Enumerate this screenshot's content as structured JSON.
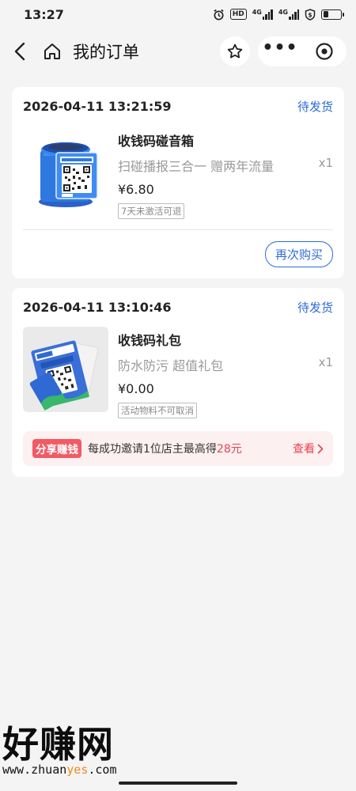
{
  "status_bar": {
    "time": "13:27",
    "hd": "HD",
    "net1": "4G",
    "net2": "4G",
    "battery_level": 0.3
  },
  "nav": {
    "title": "我的订单"
  },
  "orders": [
    {
      "time": "2026-04-11 13:21:59",
      "status": "待发货",
      "product_name": "收钱码碰音箱",
      "description": "扫碰播报三合一  赠两年流量",
      "quantity": "x1",
      "price": "¥6.80",
      "tag": "7天未激活可退",
      "action": "再次购买"
    },
    {
      "time": "2026-04-11 13:10:46",
      "status": "待发货",
      "product_name": "收钱码礼包",
      "description": "防水防污  超值礼包",
      "quantity": "x1",
      "price": "¥0.00",
      "tag": "活动物料不可取消",
      "share": {
        "badge": "分享赚钱",
        "text_before": "每成功邀请1位店主最高得",
        "amount": "28元",
        "link": "查看"
      }
    }
  ],
  "watermark": {
    "big": "好赚网",
    "small_prefix": "www.zhuan",
    "small_highlight": "yes",
    "small_suffix": ".com"
  },
  "colors": {
    "accent_blue": "#2d6bd6",
    "share_red": "#f25a64",
    "background": "#f4f4f4"
  }
}
